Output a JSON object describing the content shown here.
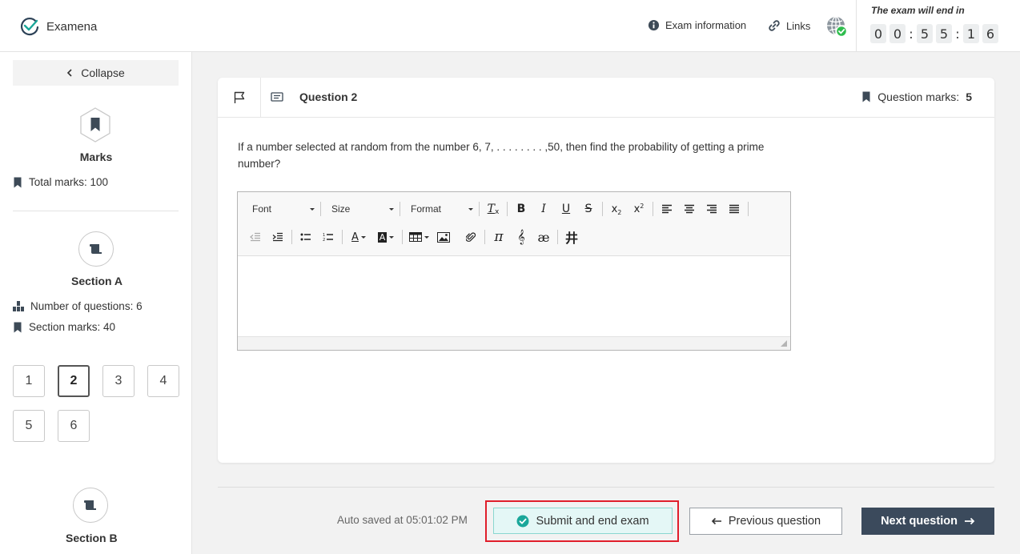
{
  "app": {
    "name": "Examena"
  },
  "header": {
    "exam_info_label": "Exam information",
    "links_label": "Links",
    "timer_label": "The exam will end in",
    "timer_digits": [
      "0",
      "0",
      "5",
      "5",
      "1",
      "6"
    ]
  },
  "sidebar": {
    "collapse_label": "Collapse",
    "marks_title": "Marks",
    "total_marks": "Total marks: 100",
    "section_a": {
      "title": "Section A",
      "num_questions": "Number of questions: 6",
      "section_marks": "Section marks: 40",
      "questions": [
        "1",
        "2",
        "3",
        "4",
        "5",
        "6"
      ],
      "active_question": "2"
    },
    "section_b": {
      "title": "Section B"
    }
  },
  "question": {
    "title": "Question 2",
    "marks_label": "Question marks:",
    "marks_value": "5",
    "text": "If a number selected at random from the number 6, 7, . . . . . . . . ,50, then find the probability of getting a prime number?"
  },
  "editor": {
    "font_label": "Font",
    "size_label": "Size",
    "format_label": "Format",
    "content": ""
  },
  "footer": {
    "autosave": "Auto saved at 05:01:02 PM",
    "submit_label": "Submit and end exam",
    "prev_label": "Previous question",
    "next_label": "Next question"
  },
  "colors": {
    "accent_dark": "#3b4a5c",
    "submit_bg": "#e4f7f6",
    "submit_check": "#1aa79a",
    "highlight_red": "#e01e2b"
  }
}
